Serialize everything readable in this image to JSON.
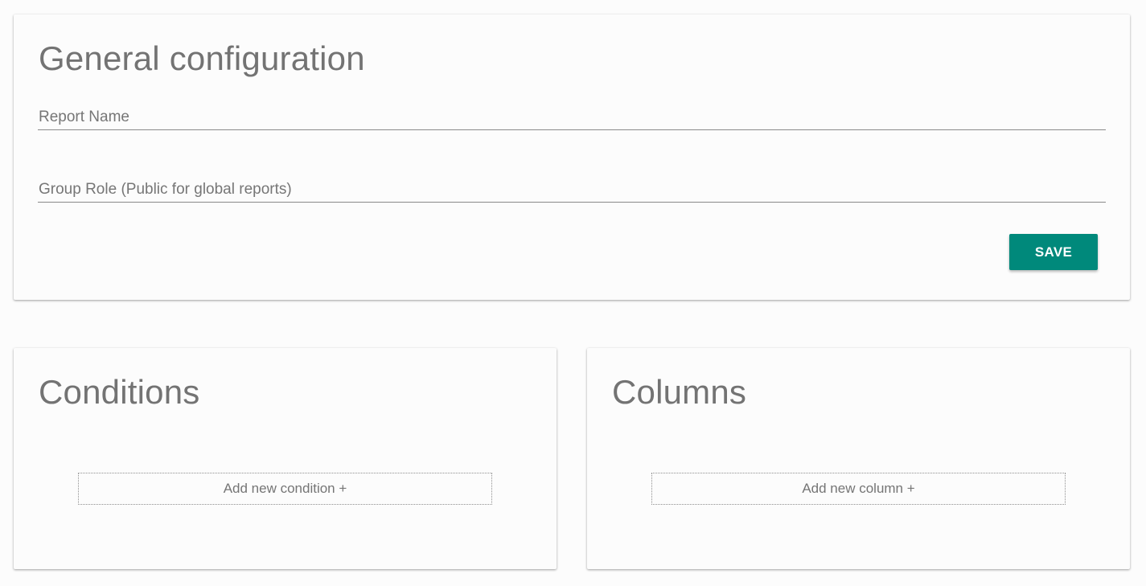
{
  "general": {
    "title": "General configuration",
    "report_name_placeholder": "Report Name",
    "report_name_value": "",
    "group_role_placeholder": "Group Role (Public for global reports)",
    "group_role_value": "",
    "save_label": "SAVE"
  },
  "conditions": {
    "title": "Conditions",
    "add_label": "Add new condition +"
  },
  "columns": {
    "title": "Columns",
    "add_label": "Add new column +"
  },
  "colors": {
    "accent": "#00897b",
    "background": "#fcfcfc",
    "text": "#757575"
  }
}
